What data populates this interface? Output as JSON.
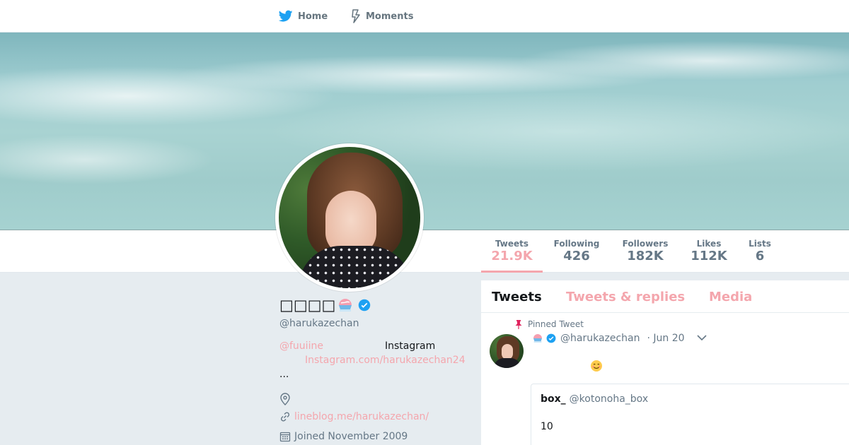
{
  "nav": {
    "home_label": "Home",
    "moments_label": "Moments"
  },
  "profile": {
    "name": "□□□□",
    "screen_name": "@harukazechan",
    "bio": {
      "mention": "@fuuiine",
      "instagram_label": "Instagram",
      "instagram_link": "Instagram.com/harukazechan24",
      "ellipsis": "..."
    },
    "url": "lineblog.me/harukazechan/",
    "joined": "Joined November 2009"
  },
  "stats": [
    {
      "label": "Tweets",
      "value": "21.9K"
    },
    {
      "label": "Following",
      "value": "426"
    },
    {
      "label": "Followers",
      "value": "182K"
    },
    {
      "label": "Likes",
      "value": "112K"
    },
    {
      "label": "Lists",
      "value": "6"
    }
  ],
  "timeline": {
    "tabs": [
      "Tweets",
      "Tweets & replies",
      "Media"
    ],
    "pinned_label": "Pinned Tweet",
    "tweet": {
      "screen_name": "@harukazechan",
      "date": "· Jun 20",
      "quote": {
        "name": "box_",
        "screen_name": "@kotonoha_box",
        "text": "10"
      }
    }
  },
  "colors": {
    "link": "#f4a6ad",
    "twitter_blue": "#1da1f2",
    "muted": "#657786"
  },
  "icons": [
    "twitter-bird-icon",
    "moments-bolt-icon",
    "shaved-ice-icon",
    "verified-icon",
    "location-icon",
    "link-icon",
    "calendar-icon",
    "pin-icon",
    "chevron-down-icon",
    "smile-icon"
  ]
}
